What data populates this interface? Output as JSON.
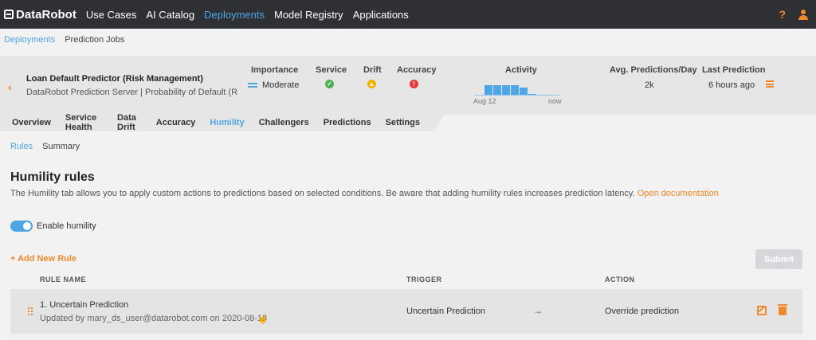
{
  "topnav": {
    "brand": "DataRobot",
    "items": [
      "Use Cases",
      "AI Catalog",
      "Deployments",
      "Model Registry",
      "Applications"
    ],
    "help": "?"
  },
  "breadcrumb": [
    "Deployments",
    "Prediction Jobs"
  ],
  "deployment": {
    "name": "Loan Default Predictor (Risk Management)",
    "subtitle": "DataRobot Prediction Server | Probability of Default (Risk Management)",
    "labels": {
      "importance": "Importance",
      "service": "Service",
      "drift": "Drift",
      "accuracy": "Accuracy",
      "activity": "Activity",
      "avg": "Avg. Predictions/Day",
      "last": "Last Prediction"
    },
    "importance_value": "Moderate",
    "service_status": {
      "color": "#4caf50",
      "glyph": "✓"
    },
    "drift_status": {
      "color": "#f2b400",
      "glyph": "▲"
    },
    "accuracy_status": {
      "color": "#e53935",
      "glyph": "!"
    },
    "activity": {
      "levels": [
        0.7,
        0.7,
        0.7,
        0.7,
        0.55,
        0.08
      ],
      "start_label": "Aug 12",
      "end_label": "now"
    },
    "avg_value": "2k",
    "last_value": "6 hours ago"
  },
  "tabs": [
    "Overview",
    "Service Health",
    "Data Drift",
    "Accuracy",
    "Humility",
    "Challengers",
    "Predictions",
    "Settings"
  ],
  "subtabs": [
    "Rules",
    "Summary"
  ],
  "page": {
    "title": "Humility rules",
    "description": "The Humility tab allows you to apply custom actions to predictions based on selected conditions. Be aware that adding humility rules increases prediction latency.",
    "doc_link": "Open documentation",
    "toggle_label": "Enable humility",
    "add_rule": "Add New Rule",
    "submit": "Submit"
  },
  "table": {
    "headers": {
      "name": "RULE NAME",
      "trigger": "TRIGGER",
      "action": "ACTION"
    },
    "rows": [
      {
        "name": "1. Uncertain Prediction",
        "updated": "Updated by mary_ds_user@datarobot.com on 2020-08-18",
        "trigger": "Uncertain Prediction",
        "action": "Override prediction"
      }
    ]
  }
}
